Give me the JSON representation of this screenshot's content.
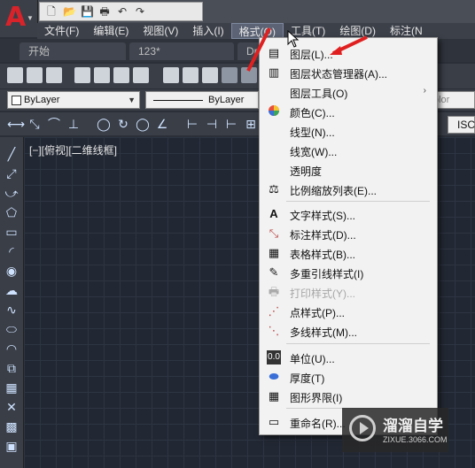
{
  "menubar": {
    "items": [
      "文件(F)",
      "编辑(E)",
      "视图(V)",
      "插入(I)",
      "格式(O)",
      "工具(T)",
      "绘图(D)",
      "标注(N"
    ],
    "active": "格式(O)"
  },
  "tabs": [
    "开始",
    "123*",
    "Dr"
  ],
  "properties": {
    "layer": "ByLayer",
    "linetype": "ByLayer",
    "color_hint": "olor"
  },
  "toolbar": {
    "iso_label": "ISC"
  },
  "viewport": {
    "label": "[−][俯视][二维线框]"
  },
  "format_menu": {
    "items": [
      {
        "label": "图层(L)...",
        "icon": "layers-icon"
      },
      {
        "label": "图层状态管理器(A)...",
        "icon": "layer-state-icon"
      },
      {
        "label": "图层工具(O)",
        "icon": "",
        "submenu": "›"
      },
      {
        "label": "颜色(C)...",
        "icon": "color-wheel-icon"
      },
      {
        "label": "线型(N)...",
        "icon": ""
      },
      {
        "label": "线宽(W)...",
        "icon": ""
      },
      {
        "label": "透明度",
        "icon": ""
      },
      {
        "label": "比例缩放列表(E)...",
        "icon": "scale-list-icon"
      },
      {
        "label": "文字样式(S)...",
        "icon": "text-style-icon"
      },
      {
        "label": "标注样式(D)...",
        "icon": "dim-style-icon"
      },
      {
        "label": "表格样式(B)...",
        "icon": "table-style-icon"
      },
      {
        "label": "多重引线样式(I)",
        "icon": "mleader-style-icon"
      },
      {
        "label": "打印样式(Y)...",
        "icon": "plot-style-icon",
        "disabled": true
      },
      {
        "label": "点样式(P)...",
        "icon": "point-style-icon"
      },
      {
        "label": "多线样式(M)...",
        "icon": "mline-style-icon"
      },
      {
        "label": "单位(U)...",
        "icon": "units-icon"
      },
      {
        "label": "厚度(T)",
        "icon": "thickness-icon"
      },
      {
        "label": "图形界限(I)",
        "icon": "drawing-limits-icon"
      },
      {
        "label": "重命名(R)...",
        "icon": "rename-icon"
      }
    ]
  },
  "watermark": {
    "title": "溜溜自学",
    "url": "ZIXUE.3066.COM"
  },
  "colors": {
    "accent_red": "#e02020",
    "menu_bg": "#f2f2f2",
    "canvas": "#222833"
  }
}
